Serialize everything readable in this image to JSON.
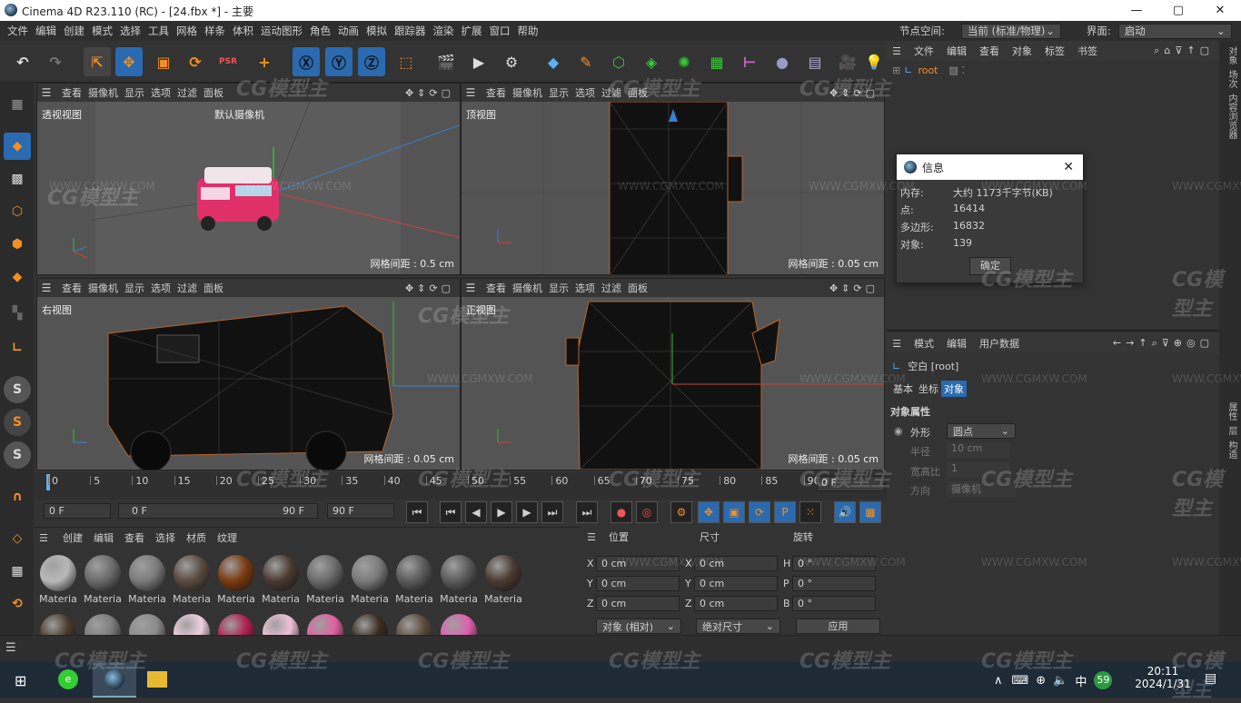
{
  "window": {
    "title": "Cinema 4D R23.110 (RC) - [24.fbx *] - 主要",
    "min": "—",
    "max": "▢",
    "close": "✕"
  },
  "menu": [
    "文件",
    "编辑",
    "创建",
    "模式",
    "选择",
    "工具",
    "网格",
    "样条",
    "体积",
    "运动图形",
    "角色",
    "动画",
    "模拟",
    "跟踪器",
    "渲染",
    "扩展",
    "窗口",
    "帮助"
  ],
  "nodespace": {
    "label": "节点空间:",
    "value": "当前 (标准/物理)"
  },
  "layout": {
    "label": "界面:",
    "value": "启动"
  },
  "viewport_menu": [
    "查看",
    "摄像机",
    "显示",
    "选项",
    "过滤",
    "面板"
  ],
  "viewports": [
    {
      "name": "透视视图",
      "grid": "网格间距 : 0.5 cm",
      "camera": "默认摄像机"
    },
    {
      "name": "顶视图",
      "grid": "网格间距 : 0.05 cm"
    },
    {
      "name": "右视图",
      "grid": "网格间距 : 0.05 cm"
    },
    {
      "name": "正视图",
      "grid": "网格间距 : 0.05 cm"
    }
  ],
  "timeline": {
    "ticks": [
      "0",
      "5",
      "10",
      "15",
      "20",
      "25",
      "30",
      "35",
      "40",
      "45",
      "50",
      "55",
      "60",
      "65",
      "70",
      "75",
      "80",
      "85",
      "90"
    ],
    "end_label": "0 F"
  },
  "transport": {
    "start": "0 F",
    "range_start": "0 F",
    "range_end": "90 F",
    "end": "90 F"
  },
  "materials": {
    "menu": [
      "创建",
      "编辑",
      "查看",
      "选择",
      "材质",
      "纹理"
    ],
    "label": "Materia",
    "row1_colors": [
      "#b8b8b8",
      "#6a6a6a",
      "#7a7a7a",
      "#5a4a40",
      "#7a3a10",
      "#4a3a30",
      "#6a6a6a",
      "#7a7a7a",
      "#5a5a5a",
      "#5a5a5a",
      "#4a3a30"
    ],
    "row2_colors": [
      "#4a3a2a",
      "#7a7a7a",
      "#8a8a8a",
      "#f0d0e0",
      "#b02050",
      "#f0c0d8",
      "#e060a0",
      "#3a2a20",
      "#5a4a3a",
      "#e060b0"
    ]
  },
  "coords": {
    "headers": [
      "位置",
      "尺寸",
      "旋转"
    ],
    "pos": [
      {
        "axis": "X",
        "value": "0 cm"
      },
      {
        "axis": "Y",
        "value": "0 cm"
      },
      {
        "axis": "Z",
        "value": "0 cm"
      }
    ],
    "size": [
      {
        "axis": "X",
        "value": "0 cm"
      },
      {
        "axis": "Y",
        "value": "0 cm"
      },
      {
        "axis": "Z",
        "value": "0 cm"
      }
    ],
    "rot": [
      {
        "axis": "H",
        "value": "0 °"
      },
      {
        "axis": "P",
        "value": "0 °"
      },
      {
        "axis": "B",
        "value": "0 °"
      }
    ],
    "mode": "对象 (相对)",
    "size_mode": "绝对尺寸",
    "apply": "应用"
  },
  "objects": {
    "menu": [
      "文件",
      "编辑",
      "查看",
      "对象",
      "标签",
      "书签"
    ],
    "root": "root"
  },
  "attributes": {
    "menu": [
      "模式",
      "编辑",
      "用户数据"
    ],
    "object": "空白 [root]",
    "tabs": [
      "基本",
      "坐标",
      "对象"
    ],
    "section": "对象属性",
    "props": [
      {
        "label": "外形",
        "value": "圆点"
      },
      {
        "label": "半径",
        "value": "10 cm"
      },
      {
        "label": "宽高比",
        "value": "1"
      },
      {
        "label": "方向",
        "value": "摄像机"
      }
    ]
  },
  "sidebar_tabs": [
    "对象",
    "场次",
    "内容浏览器",
    "属性",
    "层",
    "构造"
  ],
  "info_dialog": {
    "title": "信息",
    "rows": [
      {
        "label": "内存:",
        "value": "大约 1173千字节(KB)"
      },
      {
        "label": "点:",
        "value": "16414"
      },
      {
        "label": "多边形:",
        "value": "16832"
      },
      {
        "label": "对象:",
        "value": "139"
      }
    ],
    "ok": "确定"
  },
  "taskbar": {
    "time": "20:11",
    "date": "2024/1/31",
    "ime": "中",
    "badge": "59"
  },
  "watermark": {
    "brand": "CG模型主",
    "url": "WWW.CGMXW.COM"
  },
  "colors": {
    "accent": "#2a6ab0",
    "bg": "#333333",
    "viewport": "#545454",
    "orange": "#f29023"
  }
}
